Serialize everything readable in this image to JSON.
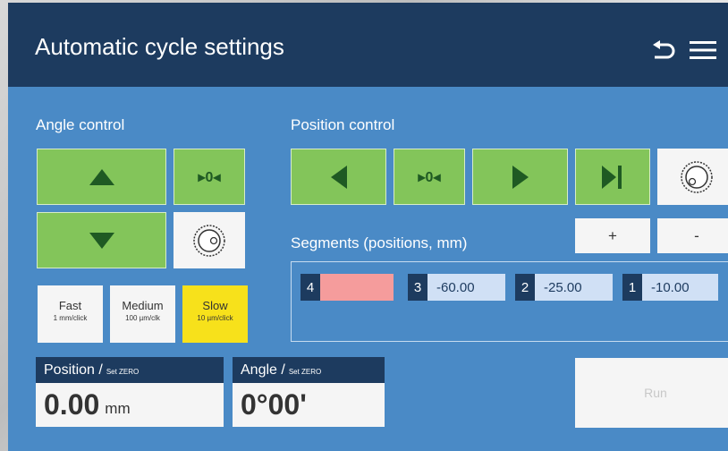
{
  "header": {
    "title": "Automatic cycle settings",
    "back_icon": "undo-arrow-icon",
    "menu_icon": "hamburger-menu-icon"
  },
  "angle_control": {
    "label": "Angle control",
    "up_icon": "triangle-up-icon",
    "zero_label": "▸0◂",
    "down_icon": "triangle-down-icon",
    "knob_icon": "knob-dial-icon"
  },
  "speed_options": [
    {
      "name": "Fast",
      "detail": "1 mm/click",
      "selected": false
    },
    {
      "name": "Medium",
      "detail": "100 µm/clk",
      "selected": false
    },
    {
      "name": "Slow",
      "detail": "10 µm/click",
      "selected": true
    }
  ],
  "position_control": {
    "label": "Position control",
    "zero_label": "▸0◂",
    "left_icon": "triangle-left-icon",
    "right_icon": "triangle-right-icon",
    "end_icon": "skip-to-end-icon",
    "knob_icon": "knob-dial-icon"
  },
  "segments": {
    "label": "Segments (positions, mm)",
    "add_label": "+",
    "remove_label": "-",
    "items": [
      {
        "index": "4",
        "value": "",
        "color": "#f59c9c"
      },
      {
        "index": "3",
        "value": "-60.00"
      },
      {
        "index": "2",
        "value": "-25.00"
      },
      {
        "index": "1",
        "value": "-10.00"
      }
    ]
  },
  "position_readout": {
    "title": "Position /",
    "set_zero": "Set ZERO",
    "value": "0.00",
    "unit": "mm"
  },
  "angle_readout": {
    "title": "Angle /",
    "set_zero": "Set ZERO",
    "value": "0°00'"
  },
  "run_label": "Run",
  "colors": {
    "header": "#1d3b5f",
    "panel": "#4a8ac6",
    "green_button": "#83c55a",
    "selected_speed": "#f7e11b"
  }
}
